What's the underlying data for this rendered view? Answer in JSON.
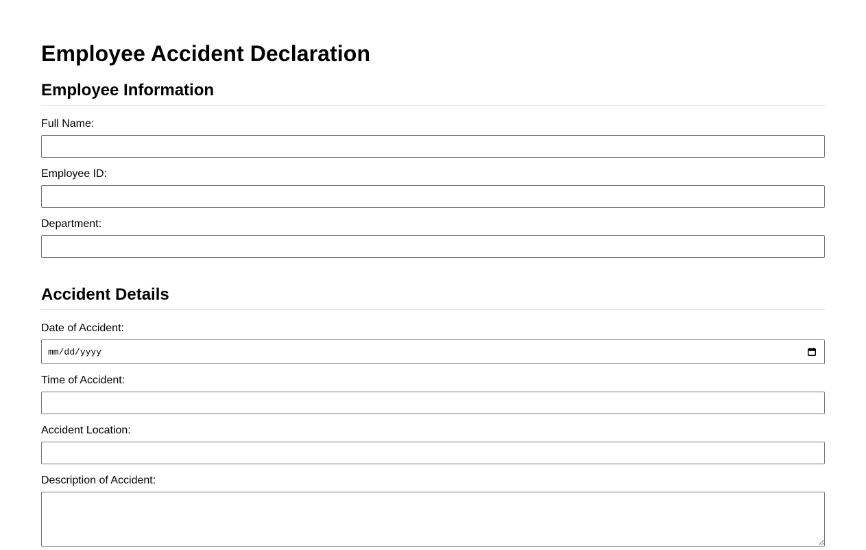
{
  "form": {
    "title": "Employee Accident Declaration"
  },
  "employee_info": {
    "heading": "Employee Information",
    "full_name_label": "Full Name:",
    "full_name_value": "",
    "employee_id_label": "Employee ID:",
    "employee_id_value": "",
    "department_label": "Department:",
    "department_value": ""
  },
  "accident_details": {
    "heading": "Accident Details",
    "date_label": "Date of Accident:",
    "date_placeholder": "mm/dd/yyyy",
    "time_label": "Time of Accident:",
    "time_value": "",
    "location_label": "Accident Location:",
    "location_value": "",
    "description_label": "Description of Accident:",
    "description_value": ""
  },
  "icons": {
    "date_picker": "calendar-icon"
  }
}
